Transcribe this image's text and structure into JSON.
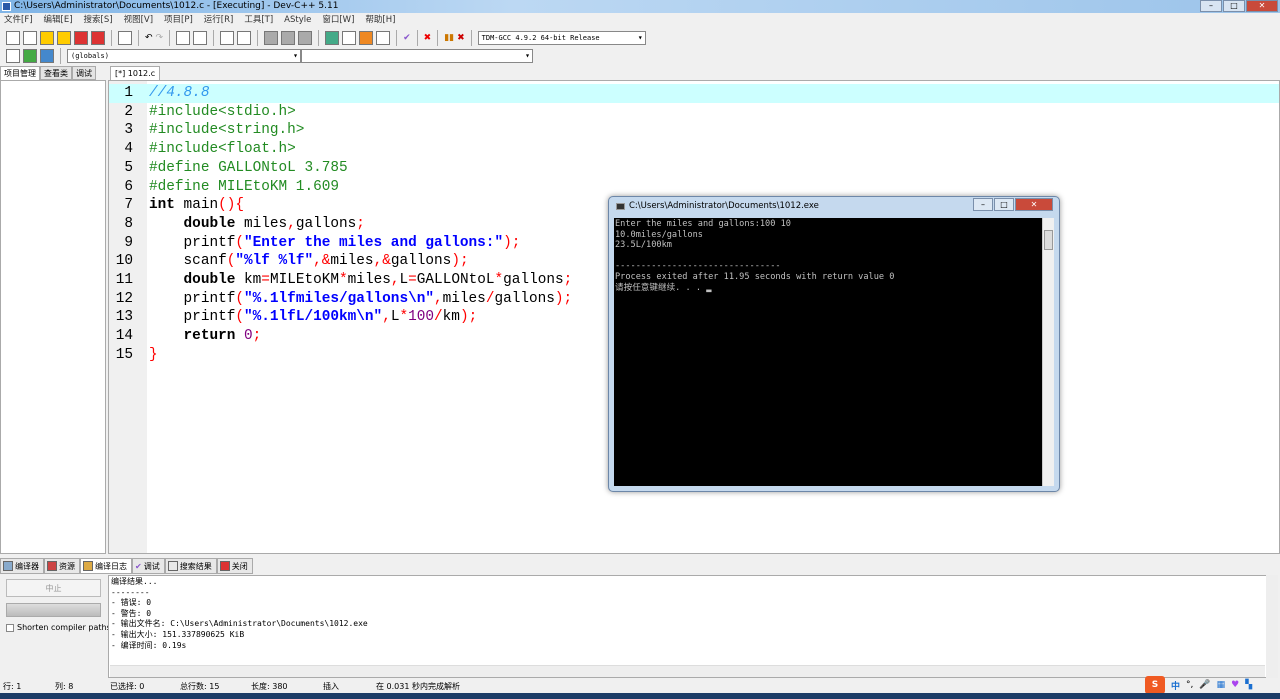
{
  "window": {
    "title": "C:\\Users\\Administrator\\Documents\\1012.c - [Executing] - Dev-C++ 5.11"
  },
  "menu": [
    "文件[F]",
    "编辑[E]",
    "搜索[S]",
    "视图[V]",
    "项目[P]",
    "运行[R]",
    "工具[T]",
    "AStyle",
    "窗口[W]",
    "帮助[H]"
  ],
  "toolbar": {
    "compiler": "TDM-GCC 4.9.2 64-bit Release",
    "scope": "(globals)",
    "symbol": ""
  },
  "left_tabs": [
    "项目管理",
    "查看类",
    "调试"
  ],
  "editor": {
    "tab": "[*] 1012.c",
    "lines": [
      [
        [
          "cm",
          "//4.8.8"
        ]
      ],
      [
        [
          "pp",
          "#include<stdio.h>"
        ]
      ],
      [
        [
          "pp",
          "#include<string.h>"
        ]
      ],
      [
        [
          "pp",
          "#include<float.h>"
        ]
      ],
      [
        [
          "pp",
          "#define GALLONtoL 3.785"
        ]
      ],
      [
        [
          "pp",
          "#define MILEtoKM 1.609"
        ]
      ],
      [
        [
          "kw",
          "int"
        ],
        [
          "id",
          " main"
        ],
        [
          "sy",
          "(){"
        ]
      ],
      [
        [
          "id",
          "    "
        ],
        [
          "kw",
          "double"
        ],
        [
          "id",
          " miles"
        ],
        [
          "sy",
          ","
        ],
        [
          "id",
          "gallons"
        ],
        [
          "sy",
          ";"
        ]
      ],
      [
        [
          "id",
          "    printf"
        ],
        [
          "sy",
          "("
        ],
        [
          "st",
          "\"Enter the miles and gallons:\""
        ],
        [
          "sy",
          ");"
        ]
      ],
      [
        [
          "id",
          "    scanf"
        ],
        [
          "sy",
          "("
        ],
        [
          "st",
          "\"%lf %lf\""
        ],
        [
          "sy",
          ",&"
        ],
        [
          "id",
          "miles"
        ],
        [
          "sy",
          ",&"
        ],
        [
          "id",
          "gallons"
        ],
        [
          "sy",
          ");"
        ]
      ],
      [
        [
          "id",
          "    "
        ],
        [
          "kw",
          "double"
        ],
        [
          "id",
          " km"
        ],
        [
          "sy",
          "="
        ],
        [
          "id",
          "MILEtoKM"
        ],
        [
          "sy",
          "*"
        ],
        [
          "id",
          "miles"
        ],
        [
          "sy",
          ","
        ],
        [
          "id",
          "L"
        ],
        [
          "sy",
          "="
        ],
        [
          "id",
          "GALLONtoL"
        ],
        [
          "sy",
          "*"
        ],
        [
          "id",
          "gallons"
        ],
        [
          "sy",
          ";"
        ]
      ],
      [
        [
          "id",
          "    printf"
        ],
        [
          "sy",
          "("
        ],
        [
          "st",
          "\"%.1lfmiles/gallons\\n\""
        ],
        [
          "sy",
          ","
        ],
        [
          "id",
          "miles"
        ],
        [
          "sy",
          "/"
        ],
        [
          "id",
          "gallons"
        ],
        [
          "sy",
          ");"
        ]
      ],
      [
        [
          "id",
          "    printf"
        ],
        [
          "sy",
          "("
        ],
        [
          "st",
          "\"%.1lfL/100km\\n\""
        ],
        [
          "sy",
          ","
        ],
        [
          "id",
          "L"
        ],
        [
          "sy",
          "*"
        ],
        [
          "nm",
          "100"
        ],
        [
          "sy",
          "/"
        ],
        [
          "id",
          "km"
        ],
        [
          "sy",
          ");"
        ]
      ],
      [
        [
          "id",
          "    "
        ],
        [
          "kw",
          "return"
        ],
        [
          "id",
          " "
        ],
        [
          "nm",
          "0"
        ],
        [
          "sy",
          ";"
        ]
      ],
      [
        [
          "sy",
          "}"
        ]
      ]
    ]
  },
  "console": {
    "title": "C:\\Users\\Administrator\\Documents\\1012.exe",
    "output": "Enter the miles and gallons:100 10\n10.0miles/gallons\n23.5L/100km\n\n--------------------------------\nProcess exited after 11.95 seconds with return value 0\n请按任意键继续. . . ▂"
  },
  "bottom_tabs": [
    "编译器",
    "资源",
    "编译日志",
    "调试",
    "搜索结果",
    "关闭"
  ],
  "bottom": {
    "stop": "中止",
    "shorten": "Shorten compiler paths",
    "log": "编译结果...\n--------\n- 错误: 0\n- 警告: 0\n- 输出文件名: C:\\Users\\Administrator\\Documents\\1012.exe\n- 输出大小: 151.337890625 KiB\n- 编译时间: 0.19s"
  },
  "status": {
    "row": "行:   1",
    "col": "列:   8",
    "sel": "已选择:   0",
    "total": "总行数:   15",
    "len": "长度:   380",
    "mode": "插入",
    "parse": "在 0.031 秒内完成解析"
  },
  "tray": {
    "ime": "S",
    "lang": "中"
  }
}
